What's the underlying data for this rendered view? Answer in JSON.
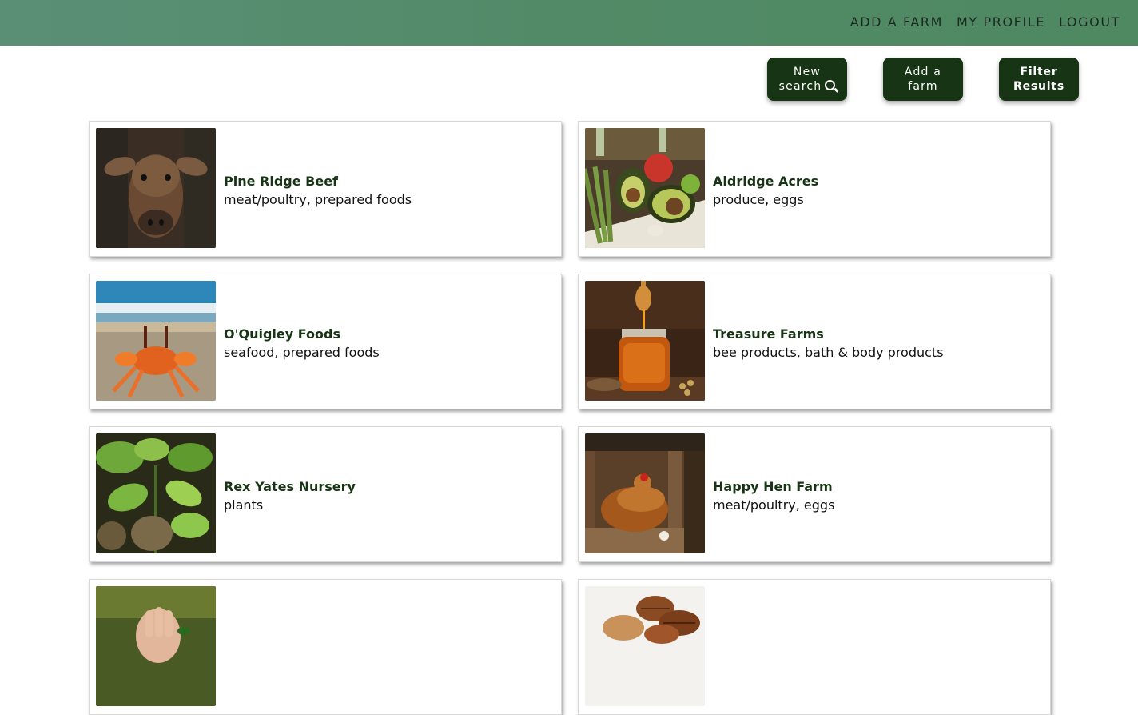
{
  "nav": {
    "items": [
      {
        "label": "ADD A FARM"
      },
      {
        "label": "MY PROFILE"
      },
      {
        "label": "LOGOUT"
      }
    ]
  },
  "actions": {
    "new_search": {
      "line1": "New",
      "line2": "search"
    },
    "add_farm": {
      "line1": "Add a",
      "line2": "farm"
    },
    "filter": {
      "line1": "Filter",
      "line2": "Results"
    }
  },
  "colors": {
    "header": "#528a67",
    "button": "#173414",
    "farm_name": "#173414"
  },
  "farms": [
    {
      "name": "Pine Ridge Beef",
      "categories": "meat/poultry, prepared foods",
      "image": "cow-photo"
    },
    {
      "name": "Aldridge Acres",
      "categories": "produce, eggs",
      "image": "vegetables-photo"
    },
    {
      "name": "O'Quigley Foods",
      "categories": "seafood, prepared foods",
      "image": "crab-photo"
    },
    {
      "name": "Treasure Farms",
      "categories": "bee products, bath & body products",
      "image": "honey-photo"
    },
    {
      "name": "Rex Yates Nursery",
      "categories": "plants",
      "image": "seedling-photo"
    },
    {
      "name": "Happy Hen Farm",
      "categories": "meat/poultry, eggs",
      "image": "hen-photo"
    },
    {
      "name": "",
      "categories": "",
      "image": "hand-photo"
    },
    {
      "name": "",
      "categories": "",
      "image": "pecans-photo"
    }
  ]
}
